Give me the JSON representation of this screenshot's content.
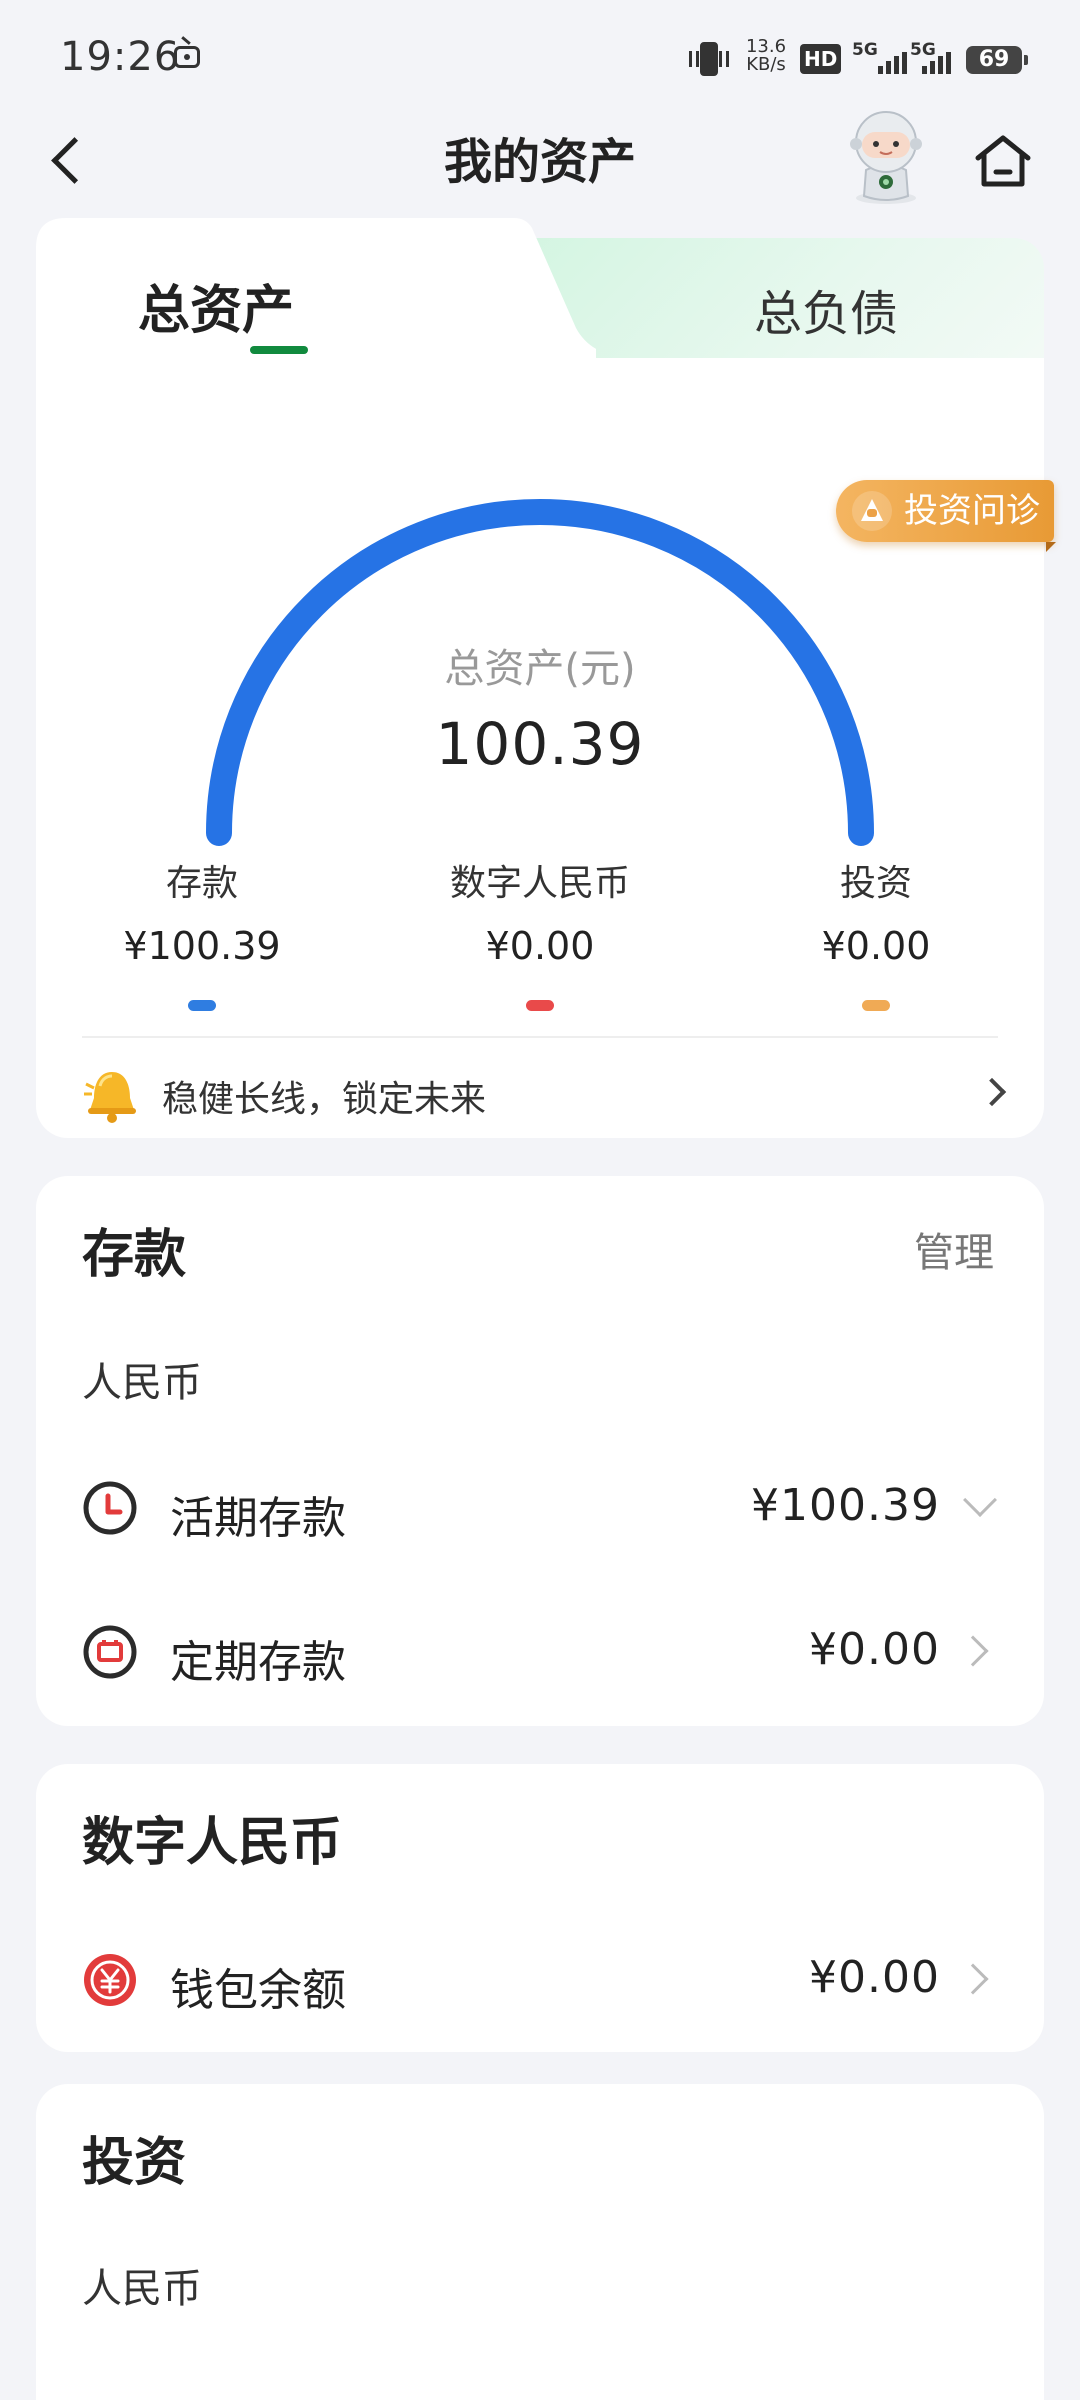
{
  "status_bar": {
    "time": "19:26",
    "net_speed_value": "13.6",
    "net_speed_unit": "KB/s",
    "hd_label": "HD",
    "sim1_label": "5G",
    "sim2_label": "5G",
    "battery": "69"
  },
  "header": {
    "title": "我的资产",
    "back_icon": "chevron-left-icon",
    "home_icon": "home-icon",
    "avatar_icon": "robot-avatar"
  },
  "tabs": [
    {
      "label": "总资产",
      "active": true
    },
    {
      "label": "总负债",
      "active": false
    }
  ],
  "overview": {
    "gauge_label": "总资产(元)",
    "total": "100.39",
    "invest_diagnosis_button": "投资问诊",
    "categories": [
      {
        "name": "存款",
        "value": "¥100.39",
        "color": "#2f7de1"
      },
      {
        "name": "数字人民币",
        "value": "¥0.00",
        "color": "#e94a4a"
      },
      {
        "name": "投资",
        "value": "¥0.00",
        "color": "#f0aa55"
      }
    ],
    "gauge_color": "#2673e5",
    "slogan": "稳健长线，锁定未来"
  },
  "deposits": {
    "title": "存款",
    "manage": "管理",
    "currency": "人民币",
    "rows": [
      {
        "label": "活期存款",
        "value": "¥100.39",
        "icon": "clock-icon"
      },
      {
        "label": "定期存款",
        "value": "¥0.00",
        "icon": "calendar-icon"
      }
    ]
  },
  "digital_rmb": {
    "title": "数字人民币",
    "rows": [
      {
        "label": "钱包余额",
        "value": "¥0.00",
        "icon": "yuan-icon"
      }
    ]
  },
  "investment": {
    "title": "投资",
    "currency": "人民币"
  },
  "colors": {
    "accent_green": "#118a3e",
    "background": "#f3f4f8"
  }
}
